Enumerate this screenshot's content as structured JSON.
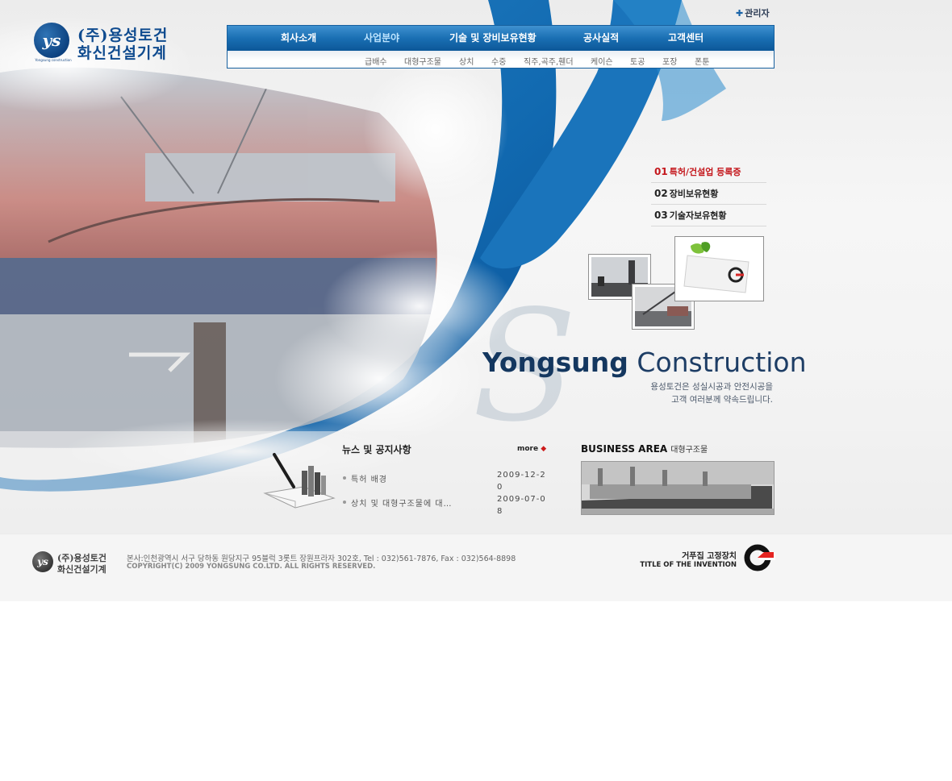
{
  "logo": {
    "mark": "ys",
    "subtitle": "Yongsung construction",
    "line1": "(주)용성토건",
    "line2": "화신건설기계"
  },
  "admin": {
    "label": "관리자",
    "icon": "plus-icon"
  },
  "nav": {
    "items": [
      "회사소개",
      "사업분야",
      "기술 및 장비보유현황",
      "공사실적",
      "고객센터"
    ],
    "active": "사업분야",
    "sub_items": [
      "급배수",
      "대형구조물",
      "상치",
      "수중",
      "직주,곡주,휀더",
      "케이슨",
      "토공",
      "포장",
      "폰툰"
    ]
  },
  "quick_menu": [
    {
      "num": "01",
      "label": "특허/건설업 등록증",
      "active": true
    },
    {
      "num": "02",
      "label": "장비보유현황",
      "active": false
    },
    {
      "num": "03",
      "label": "기술자보유현황",
      "active": false
    }
  ],
  "brand": {
    "bold": "Yongsung",
    "light": "Construction",
    "slogan_line1": "용성토건은 성실시공과 안전시공을",
    "slogan_line2": "고객 여러분께 약속드립니다."
  },
  "news": {
    "title": "뉴스 및 공지사항",
    "more": "more",
    "items": [
      {
        "text": "특허 배경",
        "date": "2009-12-20"
      },
      {
        "text": "상치 및 대형구조물에 대…",
        "date": "2009-07-08"
      }
    ]
  },
  "business": {
    "title": "BUSINESS AREA",
    "subtitle": "대형구조물"
  },
  "footer": {
    "logo_mark": "ys",
    "logo_line1": "(주)용성토건",
    "logo_line2": "화신건설기계",
    "address": "본사:인천광역시 서구 당하동 원당지구 95블럭 3롯트 장원프라자 302호, Tel : 032)561-7876, Fax : 032)564-8898",
    "copyright": "COPYRIGHT(C) 2009 YONGSUNG CO.LTD. ALL RIGHTS RESERVED.",
    "patent_ko": "거푸집 고정장치",
    "patent_en": "TITLE OF THE INVENTION"
  },
  "colors": {
    "brand_blue": "#0f5ea3",
    "nav_blue": "#1a6fb3",
    "active_red": "#c4171c",
    "footer_bg": "#f5f5f5"
  }
}
